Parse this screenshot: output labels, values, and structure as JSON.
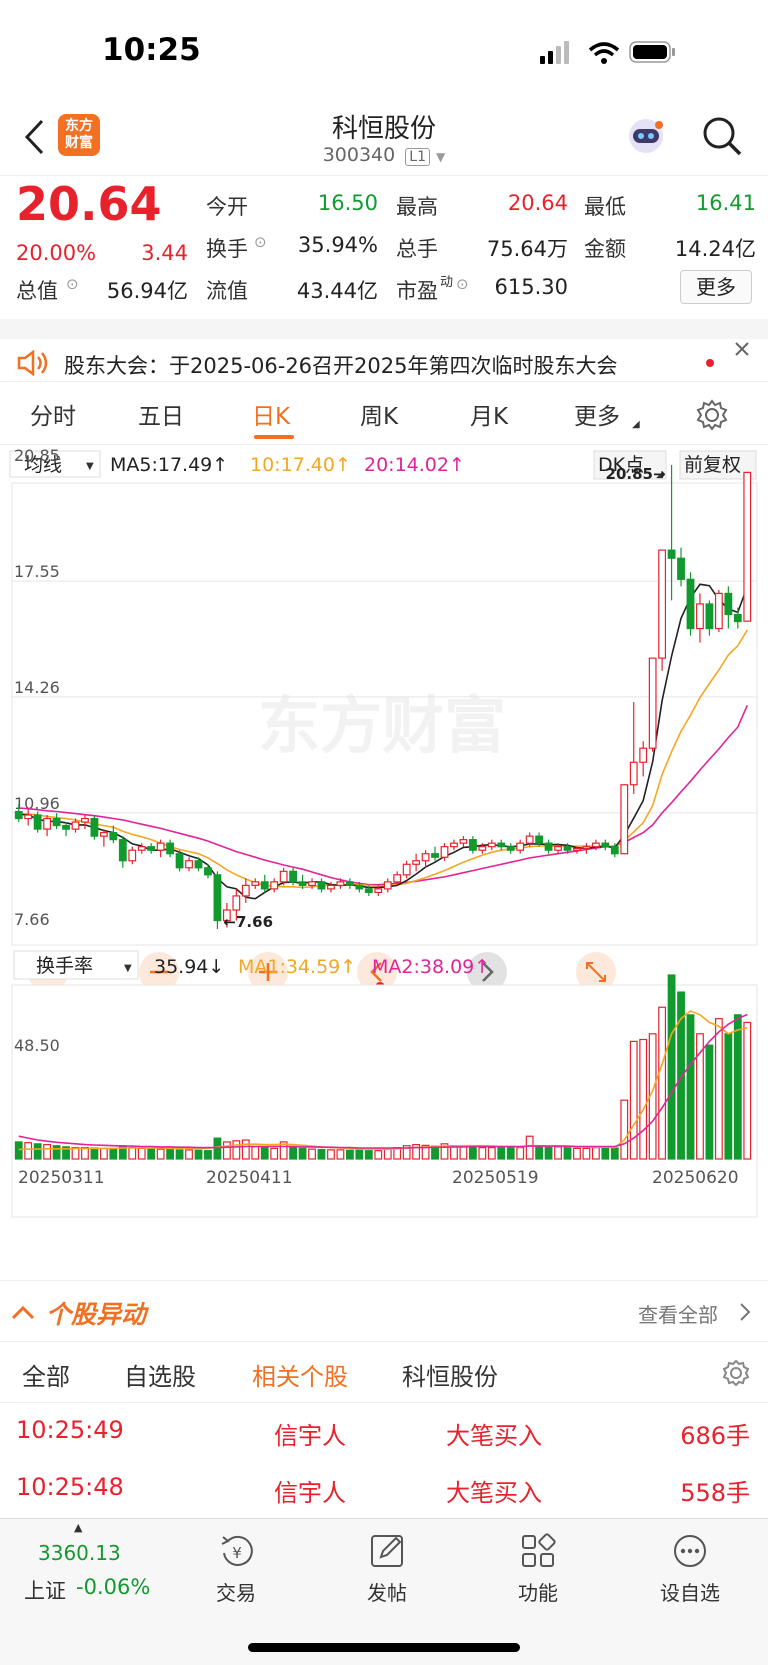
{
  "status_bar": {
    "time": "10:25"
  },
  "nav": {
    "logo_text": "东方财富",
    "stock_name": "科恒股份",
    "stock_code": "300340",
    "level_badge": "L1"
  },
  "quote": {
    "price": "20.64",
    "change_pct": "20.00%",
    "change_amt": "3.44",
    "fields": {
      "open_label": "今开",
      "open": "16.50",
      "high_label": "最高",
      "high": "20.64",
      "low_label": "最低",
      "low": "16.41",
      "turnover_label": "换手",
      "turnover": "35.94%",
      "volume_label": "总手",
      "volume": "75.64万",
      "amount_label": "金额",
      "amount": "14.24亿",
      "mktcap_label": "总值",
      "mktcap": "56.94亿",
      "float_label": "流值",
      "float": "43.44亿",
      "pe_label": "市盈",
      "pe_sup": "动",
      "pe": "615.30"
    },
    "more_button": "更多"
  },
  "notice": {
    "text": "股东大会：于2025-06-26召开2025年第四次临时股东大会"
  },
  "tabs": [
    "分时",
    "五日",
    "日K",
    "周K",
    "月K",
    "更多"
  ],
  "active_tab": "日K",
  "chart_data": {
    "type": "candlestick",
    "indicator_selector": "均线",
    "ma_labels": [
      {
        "text": "MA5:17.49↑",
        "color": "#222222"
      },
      {
        "text": "10:17.40↑",
        "color": "#f5a623"
      },
      {
        "text": "20:14.02↑",
        "color": "#e0249a"
      }
    ],
    "dk_button": "DK点",
    "adjust_button": "前复权",
    "price_ticks": [
      "20.85",
      "17.55",
      "14.26",
      "10.96",
      "7.66"
    ],
    "ylim": [
      7.66,
      20.85
    ],
    "max_annotation": "20.85",
    "min_annotation": "7.66",
    "watermark": "东方财富",
    "candles": [
      [
        11.0,
        11.2,
        10.7,
        10.8
      ],
      [
        10.8,
        11.1,
        10.6,
        10.9
      ],
      [
        10.9,
        11.0,
        10.4,
        10.5
      ],
      [
        10.5,
        10.9,
        10.3,
        10.8
      ],
      [
        10.8,
        10.95,
        10.5,
        10.6
      ],
      [
        10.6,
        10.7,
        10.3,
        10.5
      ],
      [
        10.5,
        10.8,
        10.4,
        10.7
      ],
      [
        10.7,
        10.9,
        10.5,
        10.8
      ],
      [
        10.8,
        10.9,
        10.2,
        10.3
      ],
      [
        10.3,
        10.5,
        10.0,
        10.4
      ],
      [
        10.4,
        10.6,
        10.1,
        10.2
      ],
      [
        10.2,
        10.3,
        9.4,
        9.6
      ],
      [
        9.6,
        10.0,
        9.5,
        9.9
      ],
      [
        9.9,
        10.1,
        9.8,
        10.0
      ],
      [
        10.0,
        10.1,
        9.8,
        9.9
      ],
      [
        9.9,
        10.2,
        9.7,
        10.1
      ],
      [
        10.1,
        10.2,
        9.7,
        9.8
      ],
      [
        9.8,
        9.9,
        9.3,
        9.4
      ],
      [
        9.4,
        9.7,
        9.3,
        9.6
      ],
      [
        9.6,
        9.7,
        9.3,
        9.4
      ],
      [
        9.4,
        9.5,
        9.1,
        9.2
      ],
      [
        9.2,
        9.3,
        7.66,
        7.9
      ],
      [
        7.9,
        8.4,
        7.7,
        8.2
      ],
      [
        8.2,
        8.8,
        7.9,
        8.6
      ],
      [
        8.6,
        9.1,
        8.4,
        8.9
      ],
      [
        8.9,
        9.1,
        8.8,
        9.0
      ],
      [
        9.0,
        9.2,
        8.7,
        8.8
      ],
      [
        8.8,
        9.1,
        8.7,
        9.0
      ],
      [
        9.0,
        9.4,
        8.9,
        9.3
      ],
      [
        9.3,
        9.4,
        8.9,
        9.0
      ],
      [
        9.0,
        9.2,
        8.8,
        8.9
      ],
      [
        8.9,
        9.1,
        8.8,
        9.0
      ],
      [
        9.0,
        9.1,
        8.7,
        8.8
      ],
      [
        8.8,
        9.0,
        8.7,
        8.9
      ],
      [
        8.9,
        9.1,
        8.8,
        9.0
      ],
      [
        9.0,
        9.1,
        8.8,
        8.9
      ],
      [
        8.9,
        9.0,
        8.7,
        8.8
      ],
      [
        8.8,
        8.9,
        8.6,
        8.7
      ],
      [
        8.7,
        8.9,
        8.6,
        8.8
      ],
      [
        8.8,
        9.1,
        8.7,
        9.0
      ],
      [
        9.0,
        9.3,
        8.9,
        9.2
      ],
      [
        9.2,
        9.6,
        9.1,
        9.5
      ],
      [
        9.5,
        9.8,
        9.3,
        9.6
      ],
      [
        9.6,
        9.9,
        9.4,
        9.8
      ],
      [
        9.8,
        10.0,
        9.6,
        9.7
      ],
      [
        9.7,
        10.1,
        9.6,
        10.0
      ],
      [
        10.0,
        10.2,
        9.9,
        10.1
      ],
      [
        10.1,
        10.3,
        10.0,
        10.2
      ],
      [
        10.2,
        10.3,
        9.8,
        9.9
      ],
      [
        9.9,
        10.1,
        9.8,
        10.0
      ],
      [
        10.0,
        10.2,
        9.9,
        10.1
      ],
      [
        10.1,
        10.2,
        9.9,
        10.0
      ],
      [
        10.0,
        10.1,
        9.8,
        9.9
      ],
      [
        9.9,
        10.2,
        9.8,
        10.1
      ],
      [
        10.1,
        10.4,
        10.0,
        10.3
      ],
      [
        10.3,
        10.4,
        10.0,
        10.1
      ],
      [
        10.1,
        10.2,
        9.8,
        9.9
      ],
      [
        9.9,
        10.1,
        9.8,
        10.0
      ],
      [
        10.0,
        10.1,
        9.8,
        9.9
      ],
      [
        9.9,
        10.0,
        9.8,
        9.95
      ],
      [
        9.95,
        10.1,
        9.8,
        10.0
      ],
      [
        10.0,
        10.2,
        9.9,
        10.1
      ],
      [
        10.1,
        10.2,
        9.9,
        10.0
      ],
      [
        10.0,
        10.1,
        9.7,
        9.8
      ],
      [
        9.8,
        11.76,
        9.8,
        11.76
      ],
      [
        11.76,
        14.11,
        11.5,
        12.4
      ],
      [
        12.4,
        13.0,
        12.0,
        12.8
      ],
      [
        12.8,
        15.36,
        12.7,
        15.36
      ],
      [
        15.36,
        18.43,
        15.0,
        18.43
      ],
      [
        18.43,
        20.85,
        17.0,
        18.2
      ],
      [
        18.2,
        18.5,
        17.4,
        17.6
      ],
      [
        17.6,
        17.8,
        16.0,
        16.2
      ],
      [
        16.2,
        17.2,
        15.8,
        16.9
      ],
      [
        16.9,
        17.0,
        16.0,
        16.2
      ],
      [
        16.2,
        17.3,
        16.1,
        17.2
      ],
      [
        17.2,
        17.4,
        16.2,
        16.6
      ],
      [
        16.6,
        16.8,
        16.2,
        16.4
      ],
      [
        16.41,
        20.64,
        16.41,
        20.64
      ]
    ],
    "ma5": [
      10.92,
      10.9,
      10.78,
      10.72,
      10.72,
      10.68,
      10.62,
      10.62,
      10.54,
      10.46,
      10.4,
      10.26,
      10.08,
      10.02,
      9.9,
      9.9,
      9.94,
      9.84,
      9.74,
      9.66,
      9.48,
      9.1,
      8.86,
      8.8,
      8.56,
      8.52,
      8.7,
      8.86,
      8.98,
      9.0,
      8.96,
      9.0,
      9.0,
      8.92,
      8.9,
      8.92,
      8.88,
      8.84,
      8.84,
      8.86,
      8.9,
      9.04,
      9.22,
      9.42,
      9.56,
      9.72,
      9.84,
      9.98,
      10.0,
      10.04,
      10.06,
      10.02,
      10.0,
      10.02,
      10.08,
      10.08,
      10.06,
      10.06,
      10.04,
      9.97,
      9.95,
      9.99,
      10.01,
      9.97,
      10.33,
      10.81,
      11.31,
      12.42,
      14.15,
      15.42,
      16.49,
      17.08,
      17.46,
      17.42,
      17.02,
      16.76,
      16.66,
      17.4
    ],
    "ma10": [
      10.95,
      10.93,
      10.9,
      10.86,
      10.83,
      10.8,
      10.76,
      10.7,
      10.65,
      10.6,
      10.55,
      10.44,
      10.35,
      10.28,
      10.2,
      10.1,
      10.0,
      9.92,
      9.86,
      9.8,
      9.68,
      9.52,
      9.34,
      9.2,
      9.08,
      8.98,
      8.9,
      8.88,
      8.86,
      8.86,
      8.84,
      8.86,
      8.9,
      8.92,
      8.92,
      8.92,
      8.92,
      8.9,
      8.88,
      8.9,
      8.92,
      8.96,
      9.04,
      9.12,
      9.22,
      9.32,
      9.44,
      9.56,
      9.66,
      9.76,
      9.84,
      9.9,
      9.94,
      9.96,
      10.0,
      10.02,
      10.02,
      10.02,
      10.02,
      10.02,
      10.02,
      10.02,
      10.02,
      10.0,
      10.17,
      10.42,
      10.68,
      11.17,
      12.05,
      12.7,
      13.28,
      13.74,
      14.24,
      14.64,
      15.02,
      15.45,
      15.71,
      16.16
    ],
    "ma20": [
      11.1,
      11.08,
      11.05,
      11.02,
      11.0,
      10.97,
      10.94,
      10.91,
      10.88,
      10.84,
      10.8,
      10.76,
      10.7,
      10.64,
      10.58,
      10.52,
      10.45,
      10.38,
      10.31,
      10.24,
      10.16,
      10.06,
      9.96,
      9.86,
      9.78,
      9.7,
      9.62,
      9.55,
      9.48,
      9.42,
      9.36,
      9.28,
      9.2,
      9.12,
      9.06,
      9.0,
      8.96,
      8.92,
      8.92,
      8.94,
      8.96,
      8.98,
      9.02,
      9.06,
      9.1,
      9.14,
      9.2,
      9.26,
      9.32,
      9.38,
      9.44,
      9.5,
      9.56,
      9.62,
      9.68,
      9.72,
      9.76,
      9.8,
      9.84,
      9.88,
      9.92,
      9.96,
      10.0,
      10.02,
      10.12,
      10.26,
      10.4,
      10.62,
      10.96,
      11.25,
      11.56,
      11.86,
      12.18,
      12.48,
      12.78,
      13.1,
      13.4,
      14.02
    ],
    "turnover": {
      "selector": "换手率",
      "value_label": "35.94↓",
      "ma_labels": [
        {
          "text": "MA1:34.59↑",
          "color": "#f5a623"
        },
        {
          "text": "MA2:38.09↑",
          "color": "#e0249a"
        }
      ],
      "max_tick": "48.50",
      "values": [
        4.5,
        4.3,
        4.0,
        3.8,
        3.5,
        3.2,
        3.0,
        3.0,
        2.9,
        2.8,
        2.7,
        3.5,
        3.0,
        2.8,
        2.6,
        2.6,
        2.5,
        2.4,
        2.4,
        2.3,
        2.2,
        5.5,
        4.5,
        4.8,
        5.0,
        3.2,
        3.0,
        2.8,
        4.5,
        3.0,
        2.8,
        2.6,
        2.5,
        2.4,
        2.4,
        2.3,
        2.3,
        2.2,
        2.2,
        2.6,
        3.0,
        3.5,
        3.8,
        3.6,
        3.4,
        4.0,
        3.5,
        3.4,
        3.2,
        3.0,
        3.0,
        3.1,
        3.3,
        3.0,
        6.0,
        3.5,
        3.0,
        3.2,
        3.0,
        2.8,
        2.8,
        3.0,
        3.0,
        2.9,
        15.5,
        31.0,
        31.5,
        33.0,
        40.0,
        48.5,
        44.0,
        38.0,
        33.0,
        30.0,
        37.0,
        33.0,
        38.0,
        36.0
      ],
      "ma1": [
        2.5,
        2.6,
        2.6,
        2.7,
        2.7,
        2.7,
        2.8,
        2.8,
        2.8,
        2.8,
        2.8,
        2.9,
        2.9,
        2.9,
        2.9,
        2.9,
        2.8,
        2.8,
        2.8,
        2.8,
        2.8,
        3.2,
        3.4,
        3.7,
        3.9,
        3.9,
        3.8,
        3.8,
        3.9,
        3.8,
        3.6,
        3.4,
        3.2,
        3.0,
        2.9,
        2.8,
        2.7,
        2.6,
        2.6,
        2.6,
        2.7,
        2.9,
        3.0,
        3.2,
        3.3,
        3.4,
        3.4,
        3.5,
        3.5,
        3.5,
        3.4,
        3.3,
        3.3,
        3.2,
        3.5,
        3.5,
        3.4,
        3.4,
        3.3,
        3.2,
        3.2,
        3.1,
        3.1,
        3.0,
        5.0,
        9.0,
        13.0,
        18.0,
        25.0,
        33.0,
        37.0,
        39.0,
        38.0,
        36.0,
        35.0,
        33.0,
        34.0,
        34.59
      ],
      "ma2": [
        6.0,
        5.5,
        5.0,
        4.7,
        4.4,
        4.2,
        4.0,
        3.8,
        3.7,
        3.6,
        3.5,
        3.4,
        3.4,
        3.3,
        3.3,
        3.2,
        3.2,
        3.1,
        3.1,
        3.0,
        3.0,
        3.0,
        3.1,
        3.2,
        3.3,
        3.3,
        3.3,
        3.3,
        3.3,
        3.3,
        3.2,
        3.2,
        3.1,
        3.1,
        3.0,
        3.0,
        2.9,
        2.9,
        2.9,
        2.9,
        2.9,
        2.9,
        3.0,
        3.0,
        3.1,
        3.1,
        3.2,
        3.2,
        3.3,
        3.3,
        3.3,
        3.3,
        3.3,
        3.3,
        3.4,
        3.4,
        3.4,
        3.4,
        3.4,
        3.3,
        3.3,
        3.3,
        3.3,
        3.3,
        4.0,
        5.5,
        7.5,
        10.0,
        13.5,
        17.5,
        21.5,
        25.0,
        28.0,
        31.0,
        33.5,
        35.5,
        37.0,
        38.09
      ]
    },
    "date_labels": [
      "20250311",
      "20250411",
      "20250519",
      "20250620"
    ]
  },
  "section": {
    "title": "个股异动",
    "view_all": "查看全部"
  },
  "sub_tabs": [
    "全部",
    "自选股",
    "相关个股",
    "科恒股份"
  ],
  "active_sub_tab": "相关个股",
  "alerts": [
    {
      "time": "10:25:49",
      "stock": "信宇人",
      "type": "大笔买入",
      "qty": "686手"
    },
    {
      "time": "10:25:48",
      "stock": "信宇人",
      "type": "大笔买入",
      "qty": "558手"
    }
  ],
  "bottom_bar": {
    "index_value": "3360.13",
    "index_name": "上证",
    "index_change": "-0.06%",
    "items": [
      "交易",
      "发帖",
      "功能",
      "设自选"
    ]
  },
  "colors": {
    "up": "#e8222d",
    "down": "#119a2e",
    "accent": "#f36f21"
  }
}
